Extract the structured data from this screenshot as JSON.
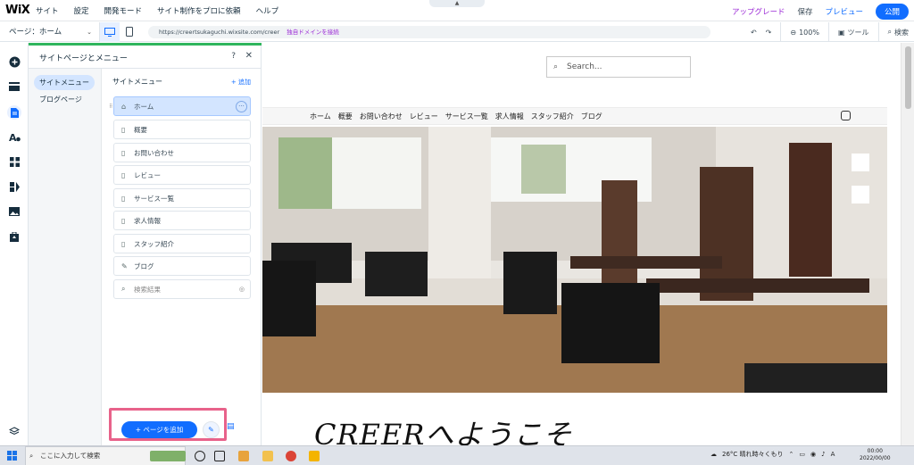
{
  "app": {
    "logo": "WiX",
    "menu": [
      "サイト",
      "設定",
      "開発モード",
      "サイト制作をプロに依頼",
      "ヘルプ"
    ],
    "upgrade": "アップグレード",
    "save": "保存",
    "preview": "プレビュー",
    "publish": "公開"
  },
  "toolbar": {
    "page_select": "ページ：ホーム",
    "url": "https://creertsukaguchi.wixsite.com/creer",
    "connect_domain": "独自ドメインを接続",
    "zoom": "100%",
    "tools": "ツール",
    "search": "検索"
  },
  "panel": {
    "title": "サイトページとメニュー",
    "help": "?",
    "close": "✕",
    "left_items": [
      {
        "label": "サイトメニュー",
        "selected": true
      },
      {
        "label": "ブログページ",
        "selected": false
      }
    ],
    "menu_title": "サイトメニュー",
    "add_label": "+ 追加",
    "pages": [
      {
        "label": "ホーム",
        "icon": "home-icon",
        "selected": true
      },
      {
        "label": "概要",
        "icon": "page-icon"
      },
      {
        "label": "お問い合わせ",
        "icon": "page-icon"
      },
      {
        "label": "レビュー",
        "icon": "page-icon"
      },
      {
        "label": "サービス一覧",
        "icon": "page-icon"
      },
      {
        "label": "求人情報",
        "icon": "page-icon"
      },
      {
        "label": "スタッフ紹介",
        "icon": "page-icon"
      },
      {
        "label": "ブログ",
        "icon": "blog-icon"
      },
      {
        "label": "検索結果",
        "icon": "search-icon",
        "hidden": true
      }
    ],
    "add_page_button": "+ ページを追加"
  },
  "site": {
    "search_placeholder": "Search...",
    "nav": [
      "ホーム",
      "概要",
      "お問い合わせ",
      "レビュー",
      "サービス一覧",
      "求人情報",
      "スタッフ紹介",
      "ブログ"
    ],
    "welcome": "CREERへようこそ"
  },
  "taskbar": {
    "search_placeholder": "ここに入力して検索",
    "weather": "26°C  晴れ時々くもり",
    "time": "00:00",
    "date": "2022/00/00"
  },
  "colors": {
    "accent": "#116dff",
    "upgrade": "#9a27d5",
    "panel_accent": "#2fb55d",
    "highlight_box": "#e8628a"
  }
}
